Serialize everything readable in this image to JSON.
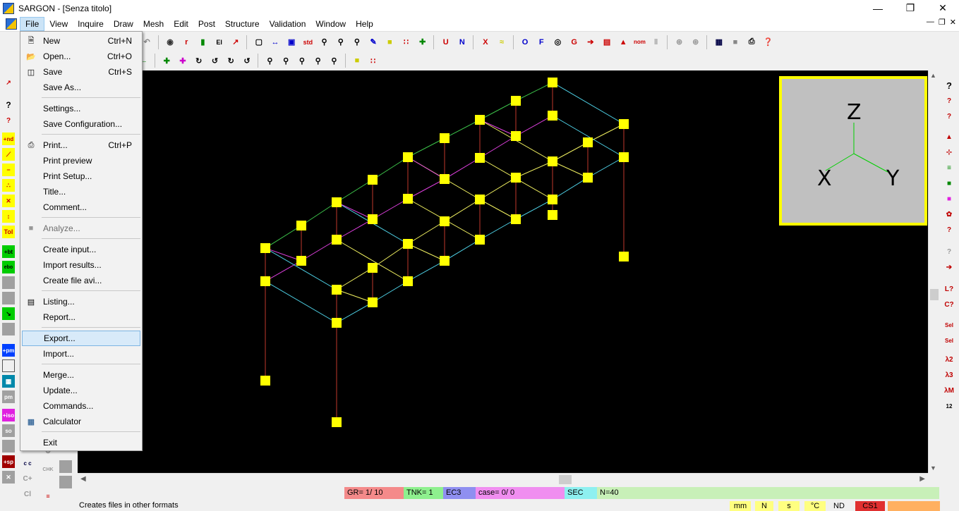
{
  "window": {
    "title": "SARGON - [Senza titolo]"
  },
  "menubar": {
    "items": [
      "File",
      "View",
      "Inquire",
      "Draw",
      "Mesh",
      "Edit",
      "Post",
      "Structure",
      "Validation",
      "Window",
      "Help"
    ]
  },
  "file_menu": {
    "new": "New",
    "new_sc": "Ctrl+N",
    "open": "Open...",
    "open_sc": "Ctrl+O",
    "save": "Save",
    "save_sc": "Ctrl+S",
    "save_as": "Save As...",
    "settings": "Settings...",
    "save_config": "Save Configuration...",
    "print": "Print...",
    "print_sc": "Ctrl+P",
    "print_preview": "Print preview",
    "print_setup": "Print Setup...",
    "title": "Title...",
    "comment": "Comment...",
    "analyze": "Analyze...",
    "create_input": "Create input...",
    "import_results": "Import results...",
    "create_avi": "Create file avi...",
    "listing": "Listing...",
    "report": "Report...",
    "export": "Export...",
    "import": "Import...",
    "merge": "Merge...",
    "update": "Update...",
    "commands": "Commands...",
    "calculator": "Calculator",
    "exit": "Exit"
  },
  "toolbar": {
    "labels": {
      "u": "U",
      "n": "N",
      "x": "X",
      "o": "O",
      "f": "F",
      "g": "G",
      "el": "El",
      "std": "std",
      "nom": "nom"
    }
  },
  "left_toolbar": {
    "nd": "+nd",
    "tol": "Tol",
    "bt": "+bt",
    "pm": "+pm",
    "pm2": "pm",
    "iso": "+iso",
    "so": "so",
    "sp": "+sp",
    "q": "?",
    "cc": "c c",
    "chk": "CHK",
    "cplus": "C+",
    "cl": "Cl"
  },
  "right_toolbar": {
    "q1": "?",
    "q2": "?",
    "q3": "?",
    "q4": "?",
    "q5": "?",
    "l": "L?",
    "c": "C?",
    "sel": "Sel",
    "sel2": "Sel",
    "l2": "λ2",
    "l3": "λ3",
    "lm": "λM",
    "n12": "12"
  },
  "axes": {
    "z": "Z",
    "x": "X",
    "y": "Y"
  },
  "status": {
    "gr": "GR=  1/ 10",
    "tnk": "TNK= 1",
    "ec3": "EC3",
    "case": "case=    0/    0",
    "sec": "SEC",
    "n": "N=40",
    "message": "Creates files in other formats",
    "units": [
      "mm",
      "N",
      "s",
      "°C",
      "ND",
      "CS1"
    ]
  },
  "colors": {
    "node": "#ffff00",
    "column": "#c0392b",
    "beam_cyan": "#4fd3e8",
    "beam_green": "#3cc24a",
    "brace_magenta": "#e040e0",
    "beam_yellow": "#f0f060",
    "gr_bg": "#f48a8a",
    "tnk_bg": "#8ef08e",
    "ec3_bg": "#8f8ff0",
    "case_bg": "#f08ef0",
    "sec_bg": "#8ef0f0",
    "n_bg": "#c8f0b8"
  }
}
